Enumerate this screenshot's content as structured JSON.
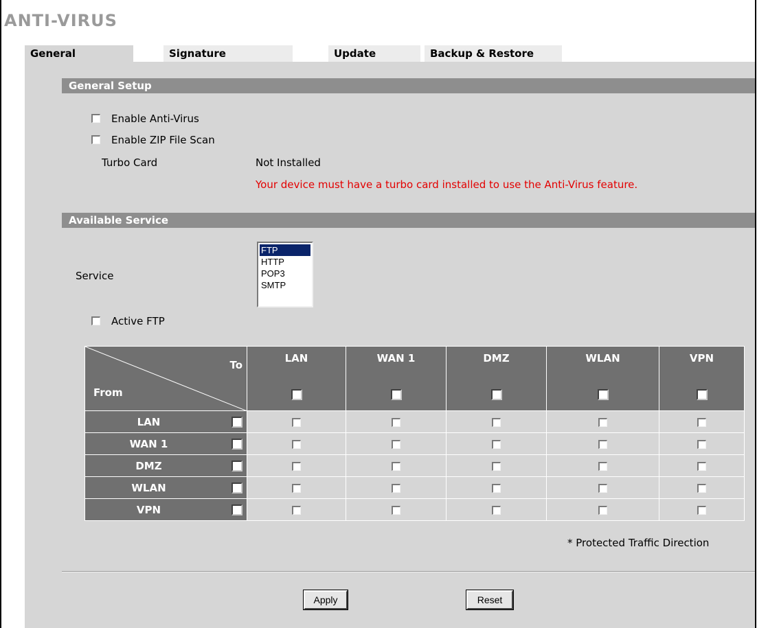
{
  "page": {
    "title": "ANTI-VIRUS"
  },
  "tabs": [
    {
      "label": "General",
      "active": true
    },
    {
      "label": "Signature"
    },
    {
      "label": "Update"
    },
    {
      "label": "Backup & Restore"
    }
  ],
  "general_setup": {
    "heading": "General Setup",
    "enable_av_label": "Enable Anti-Virus",
    "enable_zip_label": "Enable ZIP File Scan",
    "turbo_card_label": "Turbo Card",
    "turbo_card_value": "Not Installed",
    "warning": "Your device must have a turbo card installed to use the Anti-Virus feature."
  },
  "available_service": {
    "heading": "Available Service",
    "service_label": "Service",
    "service_options": [
      "FTP",
      "HTTP",
      "POP3",
      "SMTP"
    ],
    "selected_service": "FTP",
    "active_ftp_label": "Active FTP"
  },
  "matrix": {
    "to_label": "To",
    "from_label": "From",
    "columns": [
      "LAN",
      "WAN 1",
      "DMZ",
      "WLAN",
      "VPN"
    ],
    "rows": [
      "LAN",
      "WAN 1",
      "DMZ",
      "WLAN",
      "VPN"
    ],
    "note": "* Protected Traffic Direction"
  },
  "buttons": {
    "apply": "Apply",
    "reset": "Reset"
  },
  "colors": {
    "panel_bg": "#d6d6d6",
    "section_bar": "#8e8e8e",
    "matrix_header": "#707070",
    "warning": "#e30000",
    "selected_option": "#0a246a"
  }
}
